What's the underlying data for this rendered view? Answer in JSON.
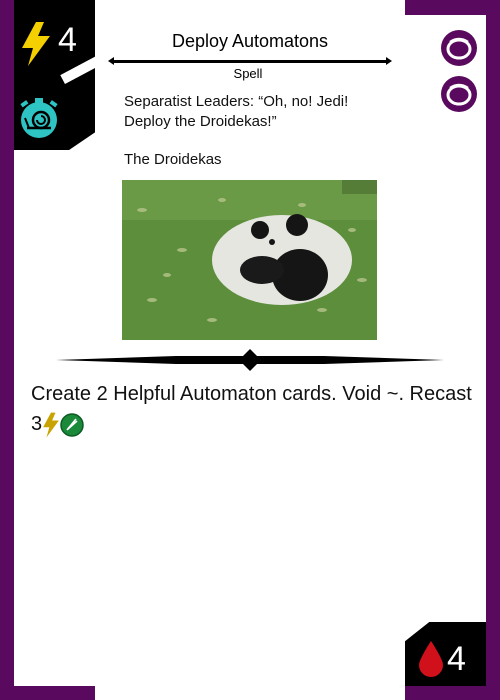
{
  "card": {
    "cost": "4",
    "title": "Deploy Automatons",
    "type": "Spell",
    "flavor_text": "Separatist Leaders: “Oh, no! Jedi! Deploy the Droidekas!”",
    "flavor_caption": "The Droidekas",
    "rules_text": "Create 2 Helpful Automaton cards. Void ~. Recast 3",
    "health": "4"
  },
  "icons": {
    "cost": "lightning-bolt-icon",
    "speed": "snail-stopwatch-icon",
    "badge_1": "purple-swirl-badge-icon",
    "badge_2": "purple-swirl-badge-icon",
    "recast_energy": "lightning-bolt-icon",
    "recast_cost": "green-quill-icon",
    "health": "blood-drop-icon"
  },
  "colors": {
    "frame": "#5a0a5e",
    "cost_bolt": "#f4d000",
    "speed_icon": "#2ec4c4",
    "health_drop": "#d0101a"
  }
}
